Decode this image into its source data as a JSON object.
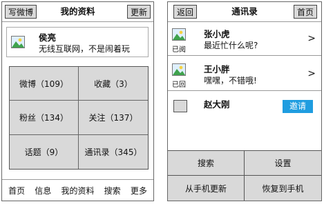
{
  "left_screen": {
    "header": {
      "left_button": "写微博",
      "title": "我的资料",
      "right_button": "更新"
    },
    "profile": {
      "name": "侯亮",
      "status": "无线互联网，不是闹着玩",
      "avatar_icon": "image-placeholder-icon"
    },
    "stats": [
      {
        "label": "微博（109）"
      },
      {
        "label": "收藏（3）"
      },
      {
        "label": "粉丝（134）"
      },
      {
        "label": "关注（137）"
      },
      {
        "label": "话题（9）"
      },
      {
        "label": "通讯录（345）"
      }
    ],
    "bottom_nav": [
      "首页",
      "信息",
      "我的资料",
      "搜索",
      "更多"
    ]
  },
  "right_screen": {
    "header": {
      "left_button": "返回",
      "title": "通讯录",
      "right_button": "首页"
    },
    "contacts": [
      {
        "name": "张小虎",
        "message": "最近忙什么呢?",
        "tag": "已阅",
        "chevron": ">"
      },
      {
        "name": "王小胖",
        "message": "嘿嘿，不错哦!",
        "tag": "已回",
        "chevron": ">"
      },
      {
        "name": "赵大刚",
        "invite_label": "邀请"
      }
    ],
    "actions": [
      "搜索",
      "设置",
      "从手机更新",
      "恢复到手机"
    ]
  },
  "colors": {
    "invite_button": "#1f9de0",
    "panel_gray": "#d9d9d9"
  }
}
